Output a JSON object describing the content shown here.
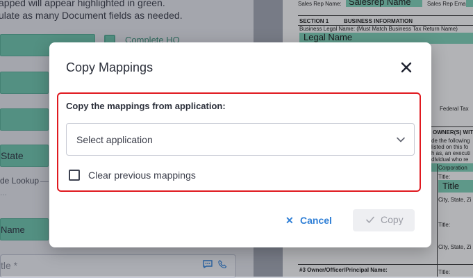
{
  "background_left": {
    "line1": "apped will appear highlighted in green.",
    "line2": "ulate as many Document fields as needed.",
    "complete_label": "Complete HQ",
    "state_label": "State",
    "lookup_label": "de Lookup",
    "name_label": "Name",
    "title_field_label": "tle *"
  },
  "background_form": {
    "sales_rep_name_label": "Sales Rep Name:",
    "sales_rep_name_value": "Salesrep Name",
    "sales_rep_email_label": "Sales Rep Email:",
    "section_label": "SECTION 1",
    "section_title": "BUSINESS INFORMATION",
    "business_legal_name_label": "Business Legal Name: (Must Match Business Tax Return Name)",
    "legal_name_value": "Legal Name",
    "federal_tax_label": "Federal Tax",
    "owners_label": "OWNER(S) WIT",
    "owners_text1": "de the following",
    "owners_text2": "listed on this fo",
    "owners_text3": "h as, an executi",
    "owners_text4": "dividual who re",
    "corporation_label": "Corporation",
    "title_label": "Title:",
    "title_value": "Title",
    "city_state_label": "City, State, Zi",
    "owner3_label": "#3 Owner/Officer/Principal Name:"
  },
  "modal": {
    "title": "Copy Mappings",
    "close_icon": "close-icon",
    "field_label": "Copy the mappings from application:",
    "select_placeholder": "Select application",
    "checkbox_label": "Clear previous mappings",
    "cancel_label": "Cancel",
    "copy_label": "Copy",
    "highlight_color": "#e0191f",
    "accent_color": "#2f7fd6"
  }
}
